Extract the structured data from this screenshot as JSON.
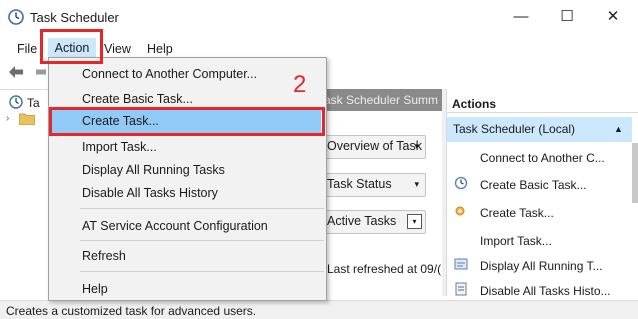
{
  "window": {
    "title": "Task Scheduler",
    "minimize_glyph": "—",
    "maximize_glyph": "☐",
    "close_glyph": "✕"
  },
  "menubar": {
    "items": [
      "File",
      "Action",
      "View",
      "Help"
    ],
    "active": "Action"
  },
  "toolbar": {
    "icons": [
      "back-arrow-icon",
      "forward-arrow-icon"
    ]
  },
  "tree": {
    "root_label": "Ta",
    "expand_glyph": "›"
  },
  "center": {
    "header": "ask Scheduler Summ",
    "sections": [
      {
        "label": "Overview of Task",
        "control": "▾"
      },
      {
        "label": "Task Status",
        "control": "▾"
      },
      {
        "label": "Active Tasks",
        "control": "▾"
      }
    ],
    "last_refreshed": "Last refreshed at 09/("
  },
  "actions_pane": {
    "header": "Actions",
    "group": "Task Scheduler (Local)",
    "group_caret": "▲",
    "items": [
      {
        "label": "Connect to Another C...",
        "icon": null
      },
      {
        "label": "Create Basic Task...",
        "icon": "create-basic-task-icon"
      },
      {
        "label": "Create Task...",
        "icon": "create-task-icon"
      },
      {
        "label": "Import Task...",
        "icon": null
      },
      {
        "label": "Display All Running T...",
        "icon": "display-running-icon"
      },
      {
        "label": "Disable All Tasks Histo...",
        "icon": "disable-history-icon"
      }
    ]
  },
  "dropdown": {
    "items": [
      "Connect to Another Computer...",
      "Create Basic Task...",
      "Create Task...",
      "Import Task...",
      "Display All Running Tasks",
      "Disable All Tasks History",
      "AT Service Account Configuration",
      "Refresh",
      "Help"
    ],
    "highlighted": "Create Task..."
  },
  "annotation": {
    "step_number": "2",
    "color": "#e8262a"
  },
  "statusbar": {
    "text": "Creates a customized task for advanced users."
  },
  "colors": {
    "menu_highlight": "#cce8ff",
    "selected_item": "#91c9f7",
    "annotation_red": "#e8262a"
  }
}
